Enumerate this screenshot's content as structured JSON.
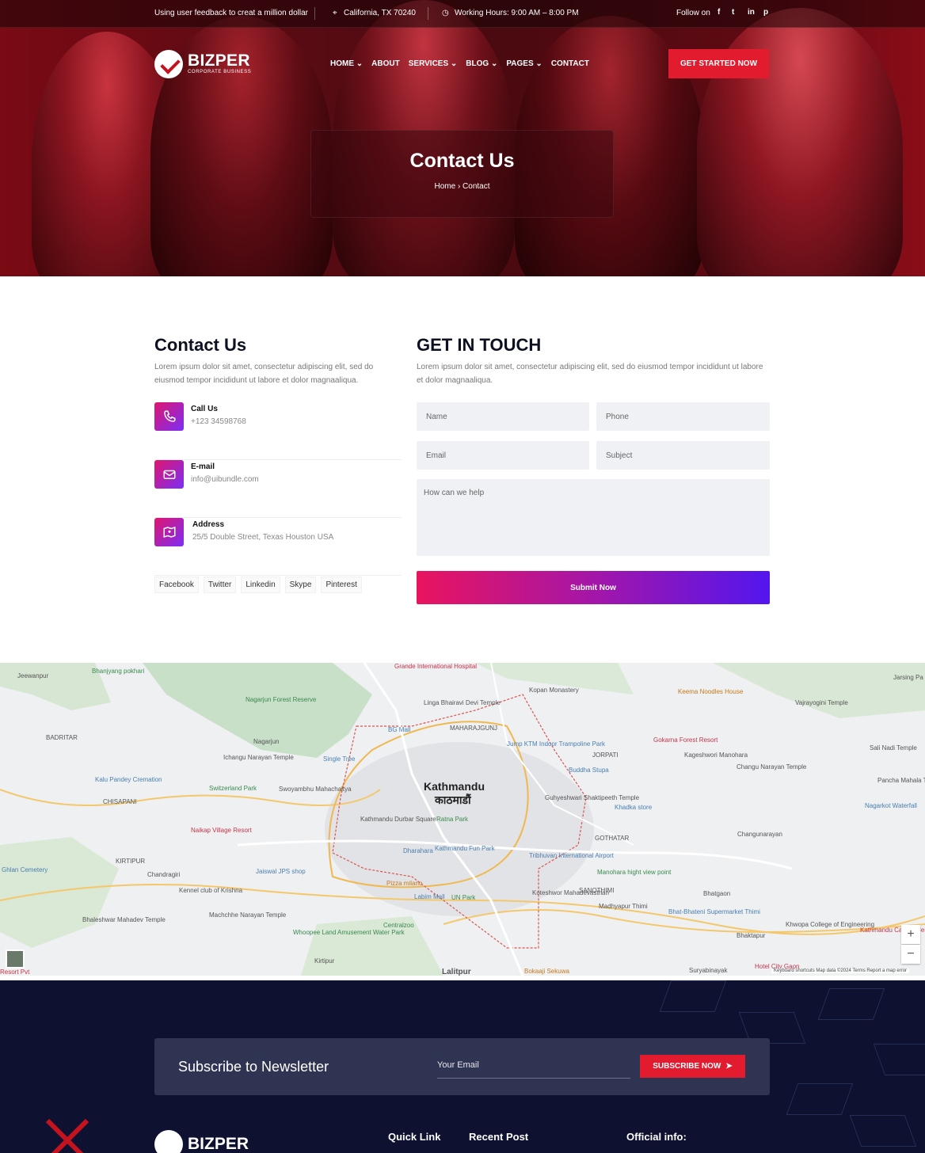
{
  "topbar": {
    "tagline": "Using user feedback to creat a million dollar",
    "location": "California, TX 70240",
    "hours": "Working Hours: 9:00 AM – 8:00 PM",
    "follow": "Follow on",
    "social_icons": [
      "facebook-icon",
      "twitter-icon",
      "linkedin-icon",
      "pinterest-icon"
    ]
  },
  "brand": {
    "name": "BIZPER",
    "tagline": "CORPORATE BUSINESS"
  },
  "nav": {
    "items": [
      {
        "label": "HOME",
        "dropdown": true
      },
      {
        "label": "ABOUT",
        "dropdown": false
      },
      {
        "label": "SERVICES",
        "dropdown": true
      },
      {
        "label": "BLOG",
        "dropdown": true
      },
      {
        "label": "PAGES",
        "dropdown": true
      },
      {
        "label": "CONTACT",
        "dropdown": false
      }
    ],
    "cta": "GET STARTED NOW"
  },
  "hero": {
    "title": "Contact Us",
    "breadcrumb": [
      "Home",
      "Contact"
    ]
  },
  "contact": {
    "title": "Contact Us",
    "intro": "Lorem ipsum dolor sit amet, consectetur adipiscing elit, sed do eiusmod tempor incididunt ut labore et dolor magnaaliqua.",
    "items": [
      {
        "icon": "phone-icon",
        "label": "Call Us",
        "value": "+123 34598768"
      },
      {
        "icon": "mail-icon",
        "label": "E-mail",
        "value": "info@uibundle.com"
      },
      {
        "icon": "map-icon",
        "label": "Address",
        "value": "25/5 Double Street, Texas Houston USA"
      }
    ],
    "social": [
      "Facebook",
      "Twitter",
      "Linkedin",
      "Skype",
      "Pinterest"
    ]
  },
  "form": {
    "title": "GET IN TOUCH",
    "intro": "Lorem ipsum dolor sit amet, consectetur adipiscing elit, sed do eiusmod tempor incididunt ut labore et dolor magnaaliqua.",
    "name": "Name",
    "phone": "Phone",
    "email": "Email",
    "subject": "Subject",
    "message": "How can we help",
    "submit": "Submit Now"
  },
  "map": {
    "city": "Kathmandu",
    "city_local": "काठमाडौं",
    "labels": [
      "Jeewanpur",
      "Bhanjyang pokhari",
      "Grande International Hospital",
      "Kopan Monastery",
      "Keema Noodles House",
      "Vajrayogini Temple",
      "Jarsing Pa",
      "Nagarjun Forest Reserve",
      "BADRITAR",
      "Nagarjun",
      "BG Mall",
      "Linga Bhairavi Devi Temple",
      "MAHARAJGUNJ",
      "Jump KTM Indoor Trampoline Park",
      "JORPATI",
      "Gokarna Forest Resort",
      "Kageshwori Manohara",
      "Sali Nadi Temple",
      "Ichangu Narayan Temple",
      "Single Tree",
      "Buddha Stupa",
      "Changu Narayan Temple",
      "Kalu Pandey Cremation",
      "Switzerland Park",
      "Swoyambhu Mahachaitya",
      "Pancha Mahala Temple",
      "CHISAPANI",
      "Guhyeshwari Shaktipeeth Temple",
      "Khadka store",
      "Nagarkot Waterfall",
      "Naikap Village Resort",
      "Kathmandu Durbar Square",
      "Ratna Park",
      "GOTHATAR",
      "Changunarayan",
      "Dharahara",
      "Kathmandu Fun Park",
      "KIRTIPUR",
      "Tribhuvan International Airport",
      "Manohara hight view point",
      "Ghlan Cemetery",
      "Jaiswal JPS shop",
      "Chandragiri",
      "Kennel club of Krishna",
      "Pizza milano",
      "Labim Mall",
      "UN Park",
      "Koteshwor Mahadevasthan",
      "SANOTHIMI",
      "Bhatgaon",
      "Machchhe Narayan Temple",
      "Madhyapur Thimi",
      "Bhat-Bhateni Supermarket Thimi",
      "Khwopa College of Engineering",
      "Kathmandu Cancer Centre",
      "Bhaleshwar Mahadev Temple",
      "Whoopee Land Amusement Water Park",
      "Centralzoo",
      "Bhaktapur",
      "Kirtipur",
      "Lalitpur",
      "Bokaaji Sekuwa",
      "Suryabinayak",
      "Hotel City Gaon",
      "Resort Pvt"
    ],
    "attribution": "Keyboard shortcuts   Map data ©2024   Terms   Report a map error",
    "zoom_in": "+",
    "zoom_out": "−"
  },
  "footer": {
    "newsletter_title": "Subscribe to Newsletter",
    "email_placeholder": "Your Email",
    "subscribe": "SUBSCRIBE NOW",
    "brand": "BIZPER",
    "headings": [
      "Quick Link",
      "Recent Post",
      "Official info:"
    ]
  },
  "colors": {
    "accent": "#e31b2e",
    "gradient_start": "#e9145f",
    "gradient_end": "#5316ee",
    "footer_bg": "#0e1230"
  }
}
